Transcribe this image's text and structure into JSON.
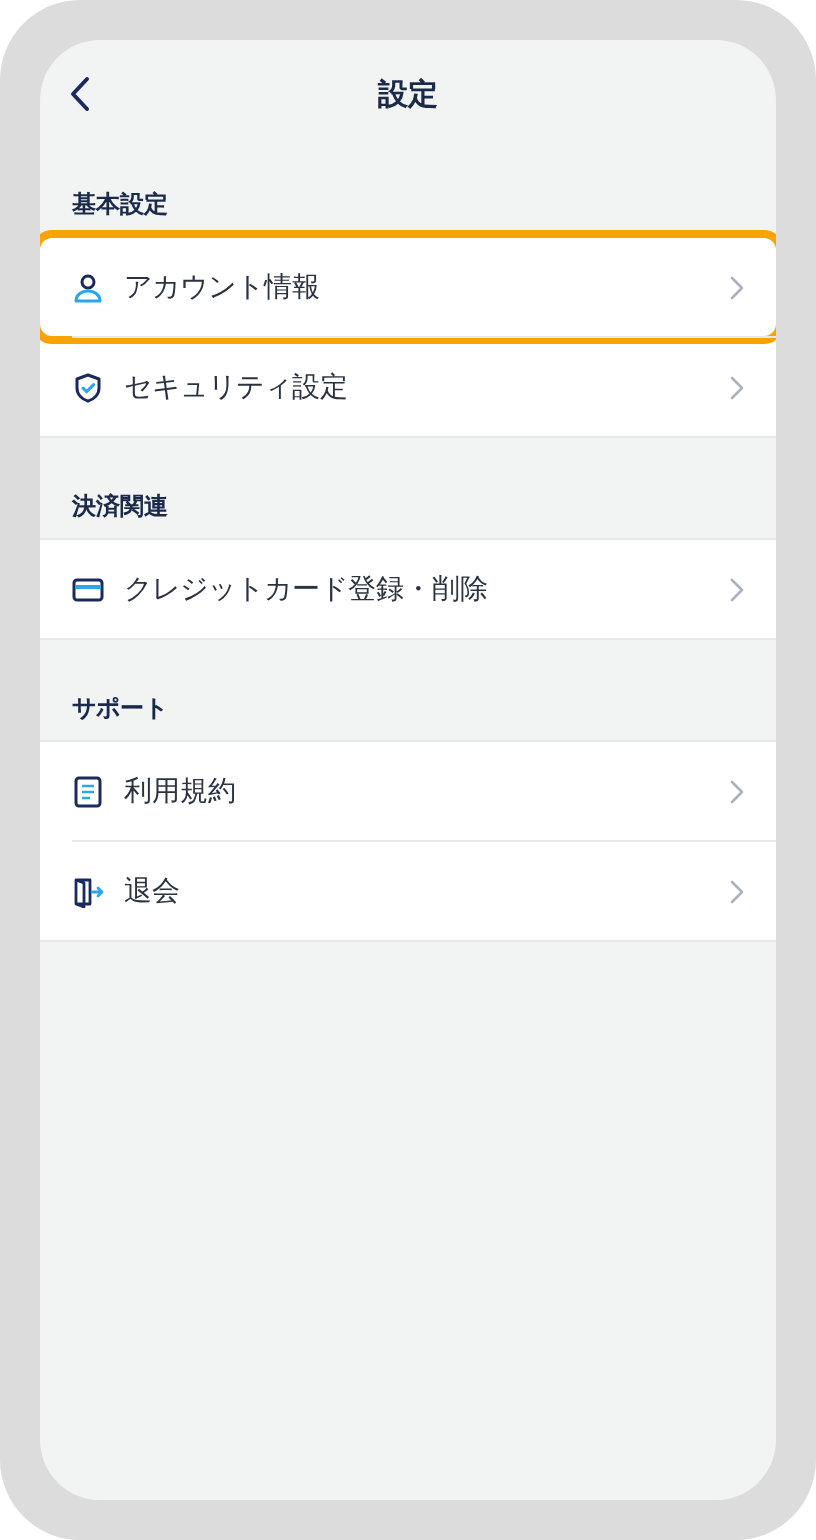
{
  "header": {
    "title": "設定"
  },
  "sections": [
    {
      "title": "基本設定",
      "items": [
        {
          "label": "アカウント情報",
          "kind": "person",
          "highlighted": true
        },
        {
          "label": "セキュリティ設定",
          "kind": "shield",
          "highlighted": false
        }
      ]
    },
    {
      "title": "決済関連",
      "items": [
        {
          "label": "クレジットカード登録・削除",
          "kind": "card",
          "highlighted": false
        }
      ]
    },
    {
      "title": "サポート",
      "items": [
        {
          "label": "利用規約",
          "kind": "document",
          "highlighted": false
        },
        {
          "label": "退会",
          "kind": "exit",
          "highlighted": false
        }
      ]
    }
  ]
}
